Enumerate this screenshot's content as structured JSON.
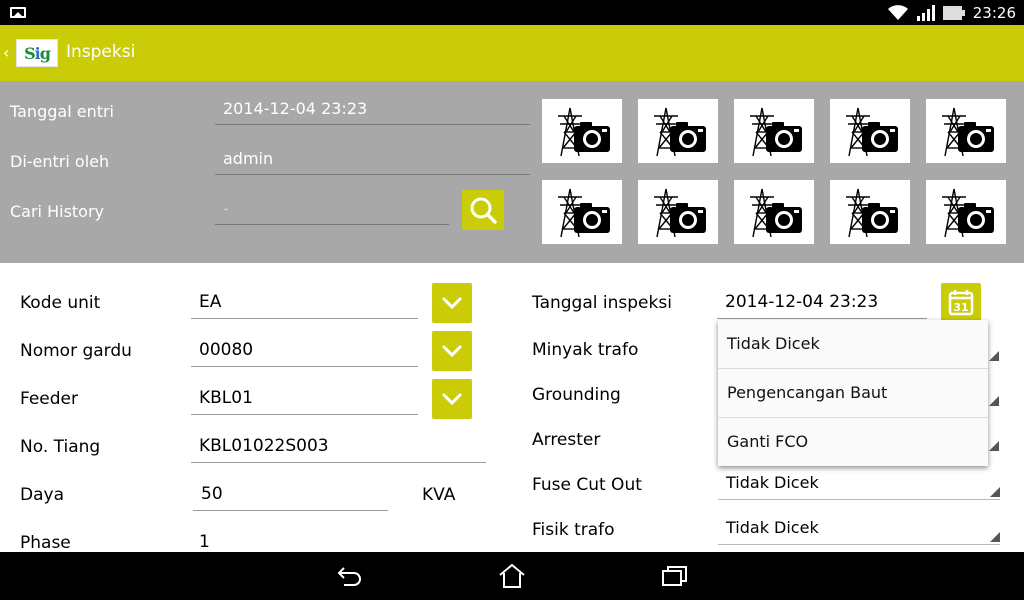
{
  "status_bar": {
    "time": "23:26",
    "icons": [
      "image-icon",
      "wifi-icon",
      "signal-icon",
      "battery-icon"
    ]
  },
  "action_bar": {
    "title": "Inspeksi",
    "logo_text_a": "S",
    "logo_text_b": "i",
    "logo_text_c": "g",
    "color": "#c9cc06"
  },
  "header": {
    "tanggal_entri_label": "Tanggal entri",
    "tanggal_entri_value": "2014-12-04 23:23",
    "dientri_oleh_label": "Di-entri oleh",
    "dientri_oleh_value": "admin",
    "cari_history_label": "Cari History",
    "cari_history_placeholder": "-"
  },
  "photos": {
    "icon": "tower-camera-icon",
    "count": 10
  },
  "form": {
    "kode_unit_label": "Kode unit",
    "kode_unit_value": "EA",
    "nomor_gardu_label": "Nomor gardu",
    "nomor_gardu_value": "00080",
    "feeder_label": "Feeder",
    "feeder_value": "KBL01",
    "no_tiang_label": "No. Tiang",
    "no_tiang_value": "KBL01022S003",
    "daya_label": "Daya",
    "daya_value": "50",
    "daya_unit": "KVA",
    "phase_label": "Phase",
    "phase_value": "1",
    "tanggal_inspeksi_label": "Tanggal inspeksi",
    "tanggal_inspeksi_value": "2014-12-04 23:23",
    "calendar_day": "31",
    "minyak_trafo_label": "Minyak trafo",
    "grounding_label": "Grounding",
    "arrester_label": "Arrester",
    "fuse_cut_out_label": "Fuse Cut Out",
    "fuse_cut_out_value": "Tidak Dicek",
    "fisik_trafo_label": "Fisik trafo",
    "fisik_trafo_value": "Tidak Dicek"
  },
  "dropdown": {
    "options": [
      "Tidak Dicek",
      "Pengencangan Baut",
      "Ganti FCO"
    ]
  },
  "nav_bar": {
    "buttons": [
      "back-icon",
      "home-icon",
      "recent-apps-icon"
    ]
  }
}
